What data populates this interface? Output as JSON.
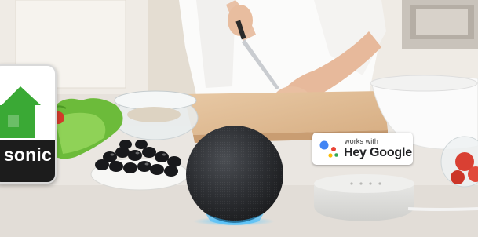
{
  "app_tile": {
    "brand_text": "sonic",
    "icon": "green-house-icon",
    "colors": {
      "icon_green": "#3aa935",
      "label_bar": "#1c1c1c"
    }
  },
  "google_badge": {
    "line1": "works with",
    "line2": "Hey Google",
    "icon": "google-assistant-icon",
    "colors": {
      "blue": "#4285f4",
      "red": "#ea4335",
      "yellow": "#fbbc05",
      "green": "#34a853"
    }
  },
  "scene": {
    "speakers": [
      "spherical-smart-speaker",
      "puck-smart-speaker"
    ],
    "colors": {
      "sphere_speaker": "#2c2e31",
      "puck_speaker": "#e4e4e2",
      "sphere_light": "#2fb7ff"
    }
  }
}
